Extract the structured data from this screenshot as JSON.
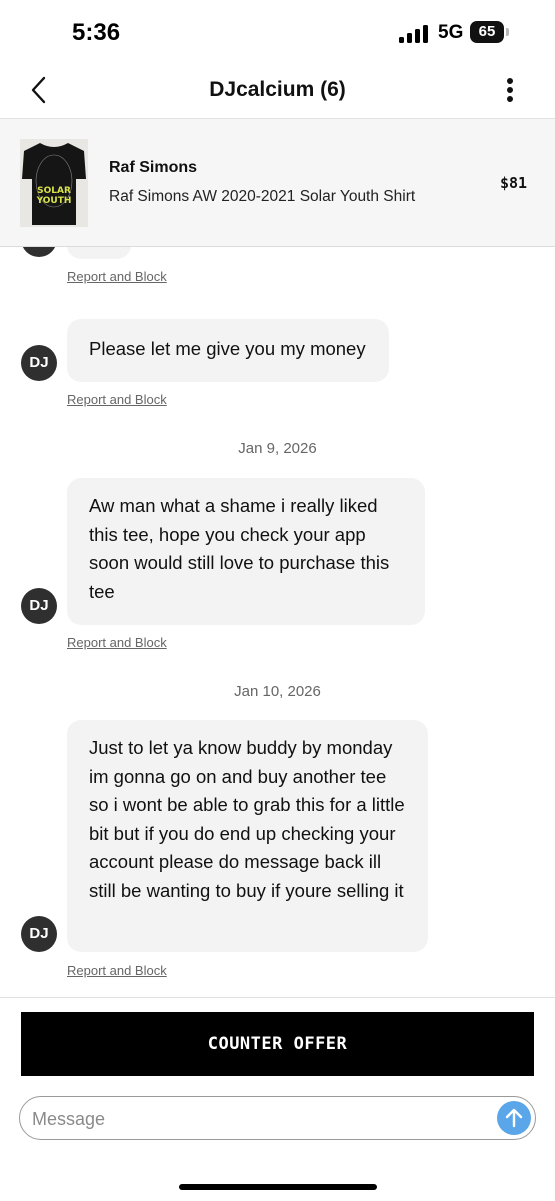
{
  "status_bar": {
    "time": "5:36",
    "network": "5G",
    "battery": "65"
  },
  "header": {
    "title": "DJcalcium (6)",
    "back_icon": "chevron-left-icon",
    "more_icon": "vertical-ellipsis-icon"
  },
  "product": {
    "brand": "Raf Simons",
    "name": "Raf Simons AW 2020-2021 Solar Youth Shirt",
    "price": "$81",
    "thumbnail_print": "SOLAR YOUTH"
  },
  "chat": {
    "avatar_initials": "DJ",
    "report_label": "Report and Block",
    "messages": [
      {
        "text": "Please let me give you my money"
      },
      {
        "date": "Jan 9, 2026",
        "text": "Aw man what a shame i really liked this tee, hope you check your app soon would still love to purchase this tee"
      },
      {
        "date": "Jan 10, 2026",
        "text": "Just to let ya know buddy by monday im gonna go on and buy another tee so i wont be able to grab this for a little bit but if you do end up checking your account please do message back ill still be wanting to buy if youre selling it"
      }
    ]
  },
  "composer": {
    "counter_offer_label": "COUNTER OFFER",
    "message_placeholder": "Message",
    "send_icon": "arrow-up-icon"
  },
  "colors": {
    "accent_send": "#5aa6e8",
    "bubble_bg": "#f3f3f3",
    "avatar_bg": "#2f2f2f",
    "button_bg": "#000000"
  }
}
